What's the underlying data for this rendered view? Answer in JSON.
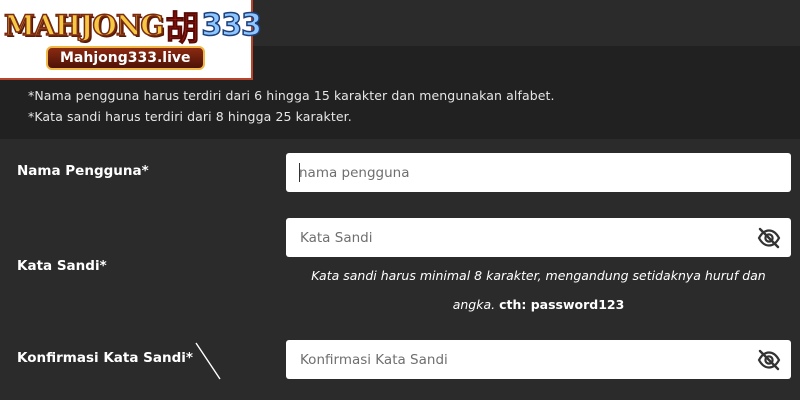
{
  "logo": {
    "brand_prefix": "MAHJONG",
    "brand_char": "胡",
    "brand_number": "333",
    "domain": "Mahjong333.live"
  },
  "notice": {
    "rule_username": "*Nama pengguna harus terdiri dari 6 hingga 15 karakter dan mengunakan alfabet.",
    "rule_password": "*Kata sandi harus terdiri dari 8 hingga 25 karakter."
  },
  "form": {
    "username": {
      "label": "Nama Pengguna*",
      "placeholder": "nama pengguna",
      "value": ""
    },
    "password": {
      "label": "Kata Sandi*",
      "placeholder": "Kata Sandi",
      "value": "",
      "toggle_icon": "eye-slash-icon",
      "hint": "Kata sandi harus minimal 8 karakter, mengandung setidaknya huruf dan angka.",
      "hint_example": "cth: password123"
    },
    "confirm_password": {
      "label": "Konfirmasi Kata Sandi*",
      "placeholder": "Konfirmasi Kata Sandi",
      "value": "",
      "toggle_icon": "eye-slash-icon"
    }
  },
  "colors": {
    "page_background": "#2b2b2b",
    "notice_background": "#212121",
    "input_background": "#ffffff",
    "logo_border": "#b8452b"
  }
}
